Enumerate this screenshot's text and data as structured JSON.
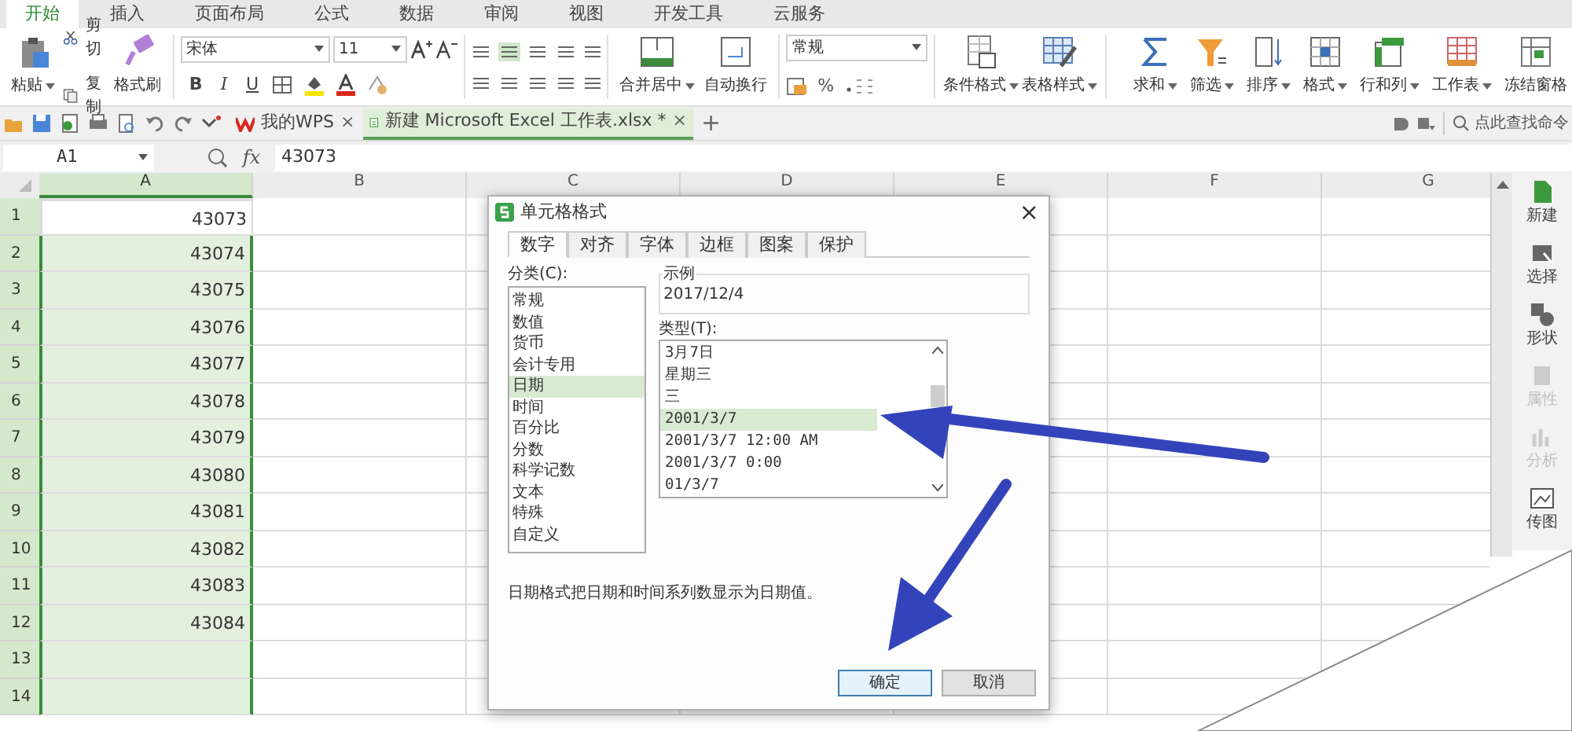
{
  "ribbon_tabs": [
    {
      "label": "开始",
      "selected": true
    },
    {
      "label": "插入",
      "selected": false
    },
    {
      "label": "页面布局",
      "selected": false
    },
    {
      "label": "公式",
      "selected": false
    },
    {
      "label": "数据",
      "selected": false
    },
    {
      "label": "审阅",
      "selected": false
    },
    {
      "label": "视图",
      "selected": false
    },
    {
      "label": "开发工具",
      "selected": false
    },
    {
      "label": "云服务",
      "selected": false
    }
  ],
  "ribbon": {
    "paste": "粘贴",
    "cut": "剪切",
    "copy": "复制",
    "format_painter": "格式刷",
    "font": "宋体",
    "font_size": "11",
    "format_buttons": [
      "B",
      "I",
      "U"
    ],
    "merge": "合并居中",
    "wrap": "自动换行",
    "number_format": "常规",
    "percent": "%",
    "style_tools": [
      "条件格式",
      "表格样式"
    ],
    "edit_tools": [
      "求和",
      "筛选",
      "排序",
      "格式",
      "行和列",
      "工作表",
      "冻结窗格"
    ]
  },
  "quick_bar": {
    "doc_tabs": [
      {
        "label": "我的WPS",
        "selected": false,
        "close": "×"
      },
      {
        "label": "新建 Microsoft Excel 工作表.xlsx *",
        "selected": true,
        "close": "×"
      }
    ],
    "new_tab": "+",
    "search": "点此查找命令"
  },
  "formula_bar": {
    "name_box": "A1",
    "fx": "fx",
    "value": "43073"
  },
  "sheet": {
    "columns": [
      {
        "label": "A",
        "selected": true
      },
      {
        "label": "B",
        "selected": false
      },
      {
        "label": "C",
        "selected": false
      },
      {
        "label": "D",
        "selected": false
      },
      {
        "label": "E",
        "selected": false
      },
      {
        "label": "F",
        "selected": false
      },
      {
        "label": "G",
        "selected": false
      }
    ],
    "rows": [
      {
        "number": "1",
        "value": "43073",
        "selected": true
      },
      {
        "number": "2",
        "value": "43074",
        "selected": true
      },
      {
        "number": "3",
        "value": "43075",
        "selected": true
      },
      {
        "number": "4",
        "value": "43076",
        "selected": true
      },
      {
        "number": "5",
        "value": "43077",
        "selected": true
      },
      {
        "number": "6",
        "value": "43078",
        "selected": true
      },
      {
        "number": "7",
        "value": "43079",
        "selected": true
      },
      {
        "number": "8",
        "value": "43080",
        "selected": true
      },
      {
        "number": "9",
        "value": "43081",
        "selected": true
      },
      {
        "number": "10",
        "value": "43082",
        "selected": true
      },
      {
        "number": "11",
        "value": "43083",
        "selected": true
      },
      {
        "number": "12",
        "value": "43084",
        "selected": true
      },
      {
        "number": "13",
        "selected": true
      },
      {
        "number": "14",
        "selected": true
      }
    ]
  },
  "dialog": {
    "title": "单元格格式",
    "close": "×",
    "tabs": [
      {
        "label": "数字",
        "selected": true
      },
      {
        "label": "对齐",
        "selected": false
      },
      {
        "label": "字体",
        "selected": false
      },
      {
        "label": "边框",
        "selected": false
      },
      {
        "label": "图案",
        "selected": false
      },
      {
        "label": "保护",
        "selected": false
      }
    ],
    "category_label": "分类(C):",
    "categories": [
      {
        "label": "常规",
        "selected": false
      },
      {
        "label": "数值",
        "selected": false
      },
      {
        "label": "货币",
        "selected": false
      },
      {
        "label": "会计专用",
        "selected": false
      },
      {
        "label": "日期",
        "selected": true
      },
      {
        "label": "时间",
        "selected": false
      },
      {
        "label": "百分比",
        "selected": false
      },
      {
        "label": "分数",
        "selected": false
      },
      {
        "label": "科学记数",
        "selected": false
      },
      {
        "label": "文本",
        "selected": false
      },
      {
        "label": "特殊",
        "selected": false
      },
      {
        "label": "自定义",
        "selected": false
      }
    ],
    "sample_label": "示例",
    "sample": "2017/12/4",
    "type_label": "类型(T):",
    "types": [
      {
        "label": "3月7日",
        "selected": false
      },
      {
        "label": "星期三",
        "selected": false
      },
      {
        "label": "三",
        "selected": false
      },
      {
        "label": "2001/3/7",
        "selected": true
      },
      {
        "label": "2001/3/7 12:00 AM",
        "selected": false
      },
      {
        "label": "2001/3/7 0:00",
        "selected": false
      },
      {
        "label": "01/3/7",
        "selected": false
      }
    ],
    "description": "日期格式把日期和时间系列数显示为日期值。",
    "buttons": [
      {
        "label": "确定",
        "default": true
      },
      {
        "label": "取消",
        "default": false
      }
    ]
  },
  "side_panel": [
    {
      "label": "新建",
      "disabled": false
    },
    {
      "label": "选择",
      "disabled": false
    },
    {
      "label": "形状",
      "disabled": false
    },
    {
      "label": "属性",
      "disabled": true
    },
    {
      "label": "分析",
      "disabled": true
    },
    {
      "label": "传图",
      "disabled": false
    }
  ]
}
